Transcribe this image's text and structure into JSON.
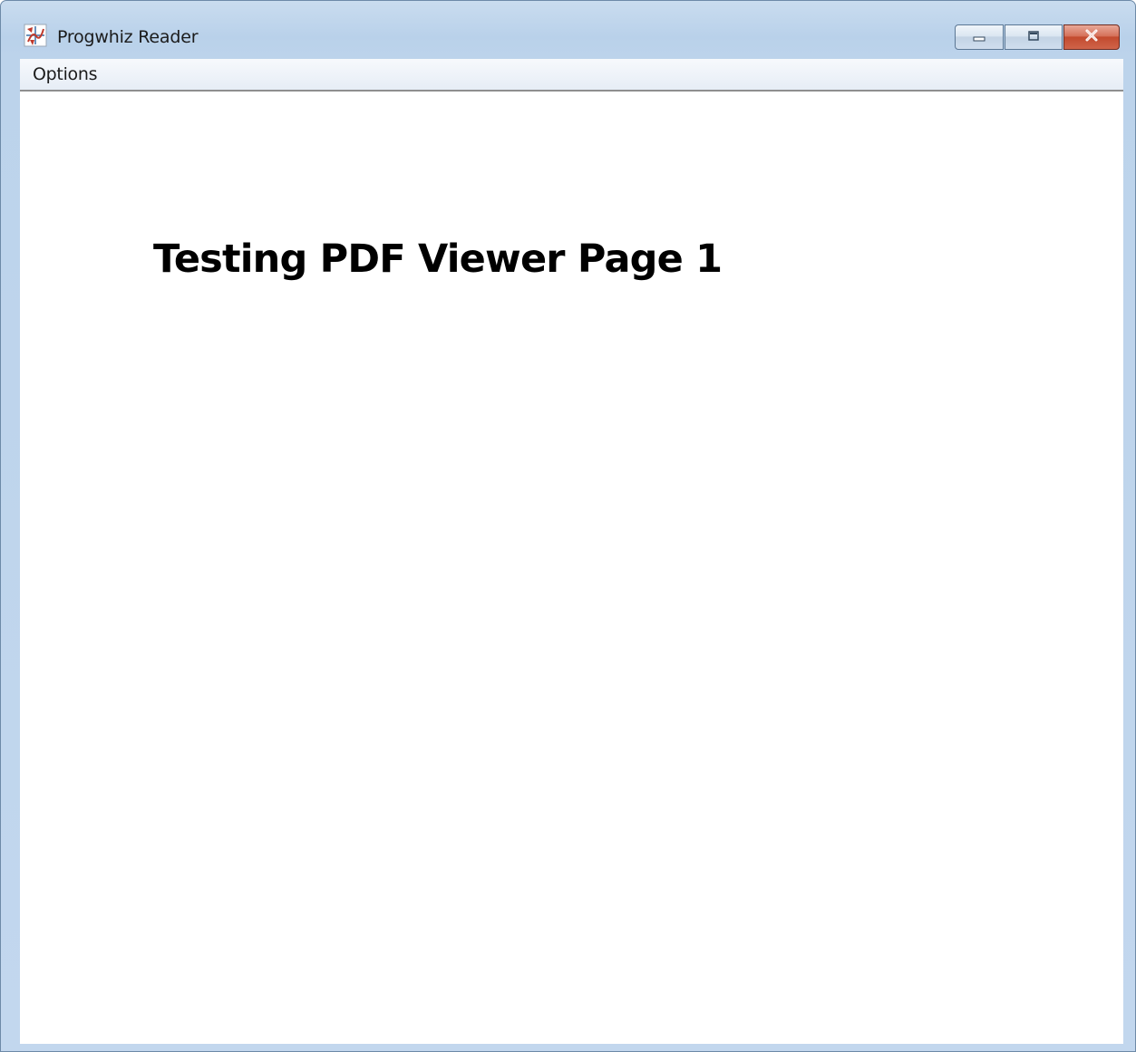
{
  "window": {
    "title": "Progwhiz Reader",
    "app_icon": "progwhiz-app-icon"
  },
  "window_controls": {
    "minimize_icon": "minimize-icon",
    "maximize_icon": "maximize-icon",
    "close_icon": "close-icon"
  },
  "menubar": {
    "items": [
      {
        "label": "Options"
      }
    ]
  },
  "document": {
    "page_heading": "Testing PDF Viewer Page 1"
  },
  "colors": {
    "frame": "#bcd3eb",
    "close_button": "#c24a2e",
    "content_background": "#ffffff",
    "text": "#000000"
  }
}
